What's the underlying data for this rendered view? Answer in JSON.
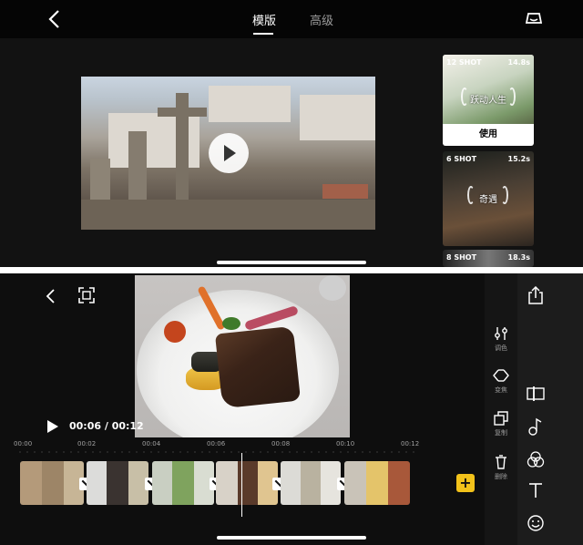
{
  "top_editor": {
    "tabs": [
      {
        "label": "模版",
        "active": true
      },
      {
        "label": "高级",
        "active": false
      }
    ],
    "templates": [
      {
        "shots": "12 SHOT",
        "duration": "14.8s",
        "title": "跃动人生",
        "action": "使用"
      },
      {
        "shots": "6 SHOT",
        "duration": "15.2s",
        "title": "奇遇"
      },
      {
        "shots": "8 SHOT",
        "duration": "18.3s"
      }
    ]
  },
  "bottom_editor": {
    "timecode": "00:06 / 00:12",
    "time_marks": [
      "00:00",
      "00:02",
      "00:04",
      "00:06",
      "00:08",
      "00:10",
      "00:12"
    ],
    "add_label": "+",
    "tools_primary": [
      {
        "label": "调色",
        "icon": "sliders-icon"
      },
      {
        "label": "变焦",
        "icon": "diamond-arrows-icon"
      },
      {
        "label": "复制",
        "icon": "copy-icon"
      },
      {
        "label": "删除",
        "icon": "trash-icon"
      }
    ],
    "tools_secondary": [
      {
        "icon": "share-icon"
      },
      {
        "icon": "split-icon"
      },
      {
        "icon": "music-note-icon"
      },
      {
        "icon": "filter-circles-icon"
      },
      {
        "icon": "text-icon"
      },
      {
        "icon": "emoji-icon"
      }
    ],
    "accent_color": "#f2c21a"
  }
}
